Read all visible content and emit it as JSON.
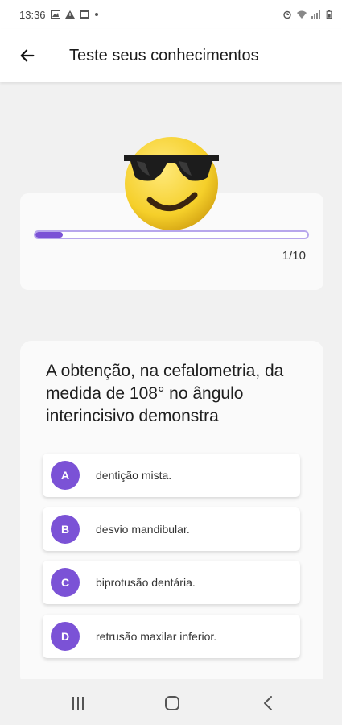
{
  "status_bar": {
    "time": "13:36",
    "left_icons": [
      "image-icon",
      "alert-icon",
      "gallery-icon",
      "dot-icon"
    ],
    "right_icons": [
      "alarm-icon",
      "wifi-icon",
      "signal-icon",
      "battery-icon"
    ]
  },
  "app_bar": {
    "title": "Teste seus conhecimentos",
    "back_icon": "arrow-left-icon"
  },
  "progress": {
    "current": 1,
    "total": 10,
    "fraction": 0.1,
    "label": "1/10"
  },
  "question": {
    "text": "A obtenção, na cefalometria, da medida de 108° no ângulo interincisivo demonstra",
    "options": [
      {
        "letter": "A",
        "text": "dentição mista."
      },
      {
        "letter": "B",
        "text": "desvio mandibular."
      },
      {
        "letter": "C",
        "text": "biprotusão dentária."
      },
      {
        "letter": "D",
        "text": "retrusão maxilar inferior."
      }
    ]
  },
  "nav": {
    "recents_icon": "recents-icon",
    "home_icon": "home-icon",
    "back_icon": "back-chevron-icon"
  },
  "colors": {
    "accent": "#7b52d6",
    "progress_border": "#b7a6ec",
    "background": "#f1f1f1",
    "card": "#fafafa"
  }
}
